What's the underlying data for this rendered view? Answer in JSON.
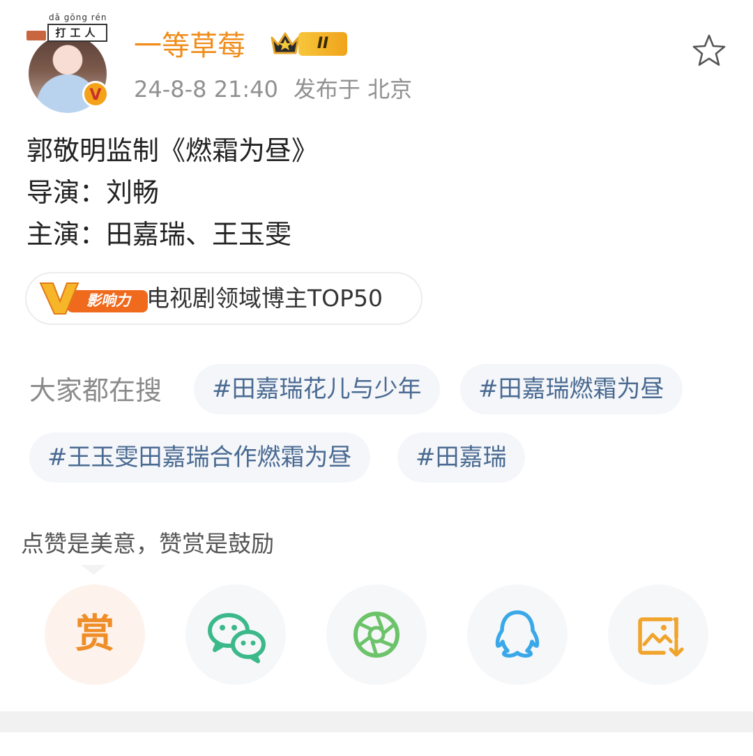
{
  "post": {
    "username": "一等草莓",
    "level_badge": "II",
    "timestamp": "24-8-8 21:40",
    "location_label": "发布于 北京",
    "avatar_stamp_pinyin": "dǎ gōng rén",
    "avatar_stamp_text": "打工人",
    "verify_mark": "V",
    "content": [
      "郭敬明监制《燃霜为昼》",
      "导演：刘畅",
      "主演：田嘉瑞、王玉雯"
    ]
  },
  "influence": {
    "badge_text": "影响力",
    "badge_letter": "V",
    "label": "电视剧领域博主TOP50"
  },
  "trending": {
    "label": "大家都在搜",
    "tags": [
      "#田嘉瑞花儿与少年",
      "#田嘉瑞燃霜为昼",
      "#王玉雯田嘉瑞合作燃霜为昼",
      "#田嘉瑞"
    ]
  },
  "reward": {
    "tip": "点赞是美意，赞赏是鼓励",
    "reward_glyph": "赏"
  },
  "share_icons": [
    "reward-icon",
    "wechat-icon",
    "moments-icon",
    "qq-icon",
    "save-image-icon"
  ],
  "colors": {
    "username": "#f08c1a",
    "tag_text": "#4a6a92",
    "wechat": "#3cb98a",
    "moments": "#6cc36a",
    "qq": "#3aa8e8",
    "save": "#f0a42b",
    "reward": "#ef8d28"
  }
}
